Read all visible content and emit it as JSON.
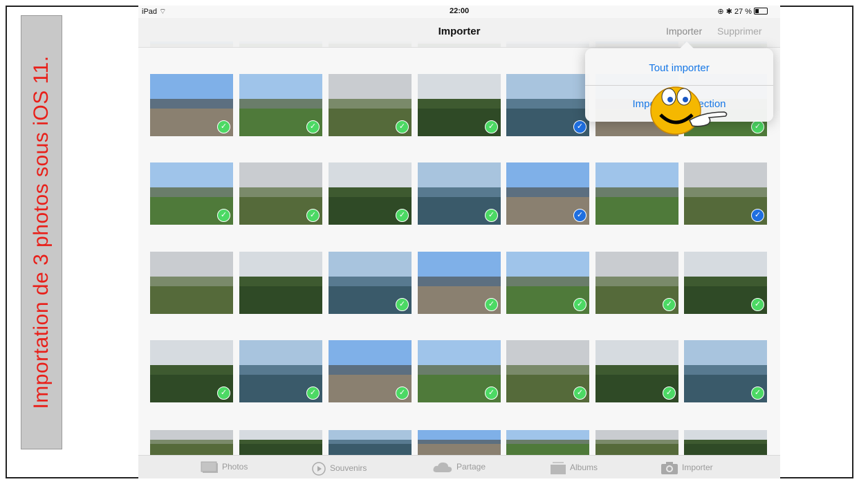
{
  "side_label": "Importation de 3 photos sous iOS 11.",
  "status_bar": {
    "device": "iPad",
    "time": "22:00",
    "battery": "27 %"
  },
  "nav": {
    "title": "Importer",
    "import_button": "Importer",
    "delete_button": "Supprimer"
  },
  "popover": {
    "import_all": "Tout importer",
    "import_selection": "Importer la sélection"
  },
  "tabs": [
    "Photos",
    "Souvenirs",
    "Partage",
    "Albums",
    "Importer"
  ],
  "colors": {
    "check_green": "#4cd964",
    "check_blue": "#1f6fe0",
    "link_blue": "#1677e6",
    "label_red": "#e8201a"
  },
  "photo_rows": [
    [
      "green",
      "green",
      "green",
      "green",
      "blue",
      "green",
      "green"
    ],
    [
      "green",
      "green",
      "green",
      "green",
      "blue",
      "none",
      "blue"
    ],
    [
      "none",
      "none",
      "green",
      "green",
      "green",
      "green",
      "green"
    ],
    [
      "green",
      "green",
      "green",
      "green",
      "green",
      "green",
      "green"
    ]
  ]
}
